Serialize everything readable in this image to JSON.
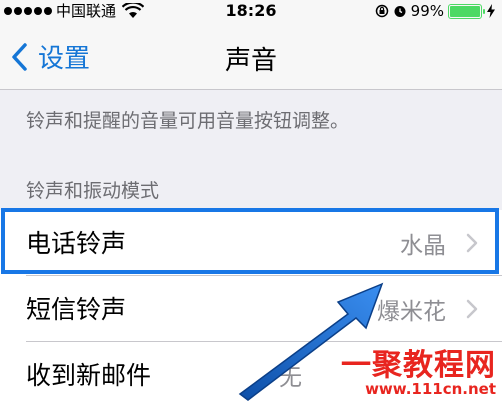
{
  "status_bar": {
    "carrier": "中国联通",
    "time": "18:26",
    "battery_percent": "99%",
    "battery_level": 0.99
  },
  "nav": {
    "back_label": "设置",
    "title": "声音"
  },
  "hint_text": "铃声和提醒的音量可用音量按钮调整。",
  "section_header": "铃声和振动模式",
  "cells": [
    {
      "label": "电话铃声",
      "value": "水晶"
    },
    {
      "label": "短信铃声",
      "value": "爆米花"
    },
    {
      "label": "收到新邮件",
      "value": "无"
    }
  ],
  "watermark": {
    "logo": "一聚教程网",
    "url": "www.111cn.net"
  },
  "colors": {
    "accent": "#1576d6",
    "highlight": "#1877e6",
    "battery": "#4cd964",
    "watermark": "#e8251f"
  }
}
